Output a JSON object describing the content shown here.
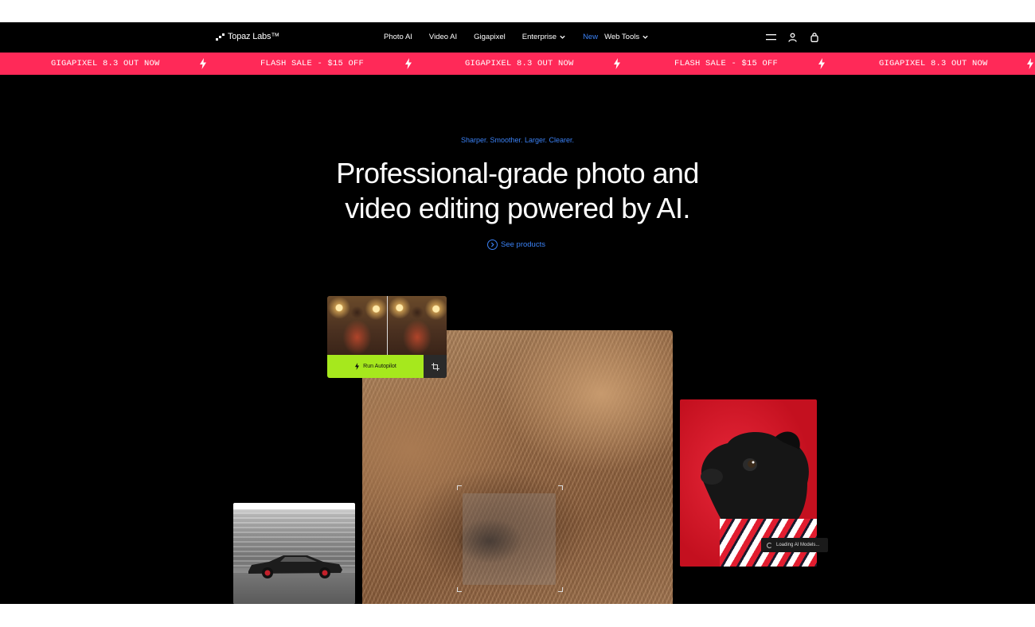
{
  "nav": {
    "logo_text": "Topaz Labs™",
    "links": [
      {
        "label": "Photo AI"
      },
      {
        "label": "Video AI"
      },
      {
        "label": "Gigapixel"
      },
      {
        "label": "Enterprise",
        "has_dropdown": true
      },
      {
        "badge": "New",
        "label": "Web Tools",
        "has_dropdown": true
      }
    ],
    "icons": [
      "menu-icon",
      "account-icon",
      "cart-icon"
    ]
  },
  "promo": {
    "background": "#ff2958",
    "items": [
      "GIGAPIXEL 8.3 OUT NOW",
      "FLASH SALE - $15 OFF",
      "GIGAPIXEL 8.3 OUT NOW",
      "FLASH SALE - $15 OFF",
      "GIGAPIXEL 8.3 OUT NOW"
    ],
    "separator_icon": "lightning-bolt-icon"
  },
  "hero": {
    "tagline": "Sharper. Smoother. Larger. Clearer.",
    "headline_line1": "Professional-grade photo and",
    "headline_line2": "video editing powered by AI.",
    "cta_label": "See products",
    "accent": "#3b82f6"
  },
  "showcase": {
    "autopilot_label": "Run Autopilot",
    "autopilot_color": "#a6e81d",
    "loading_label": "Loading AI Models..."
  }
}
